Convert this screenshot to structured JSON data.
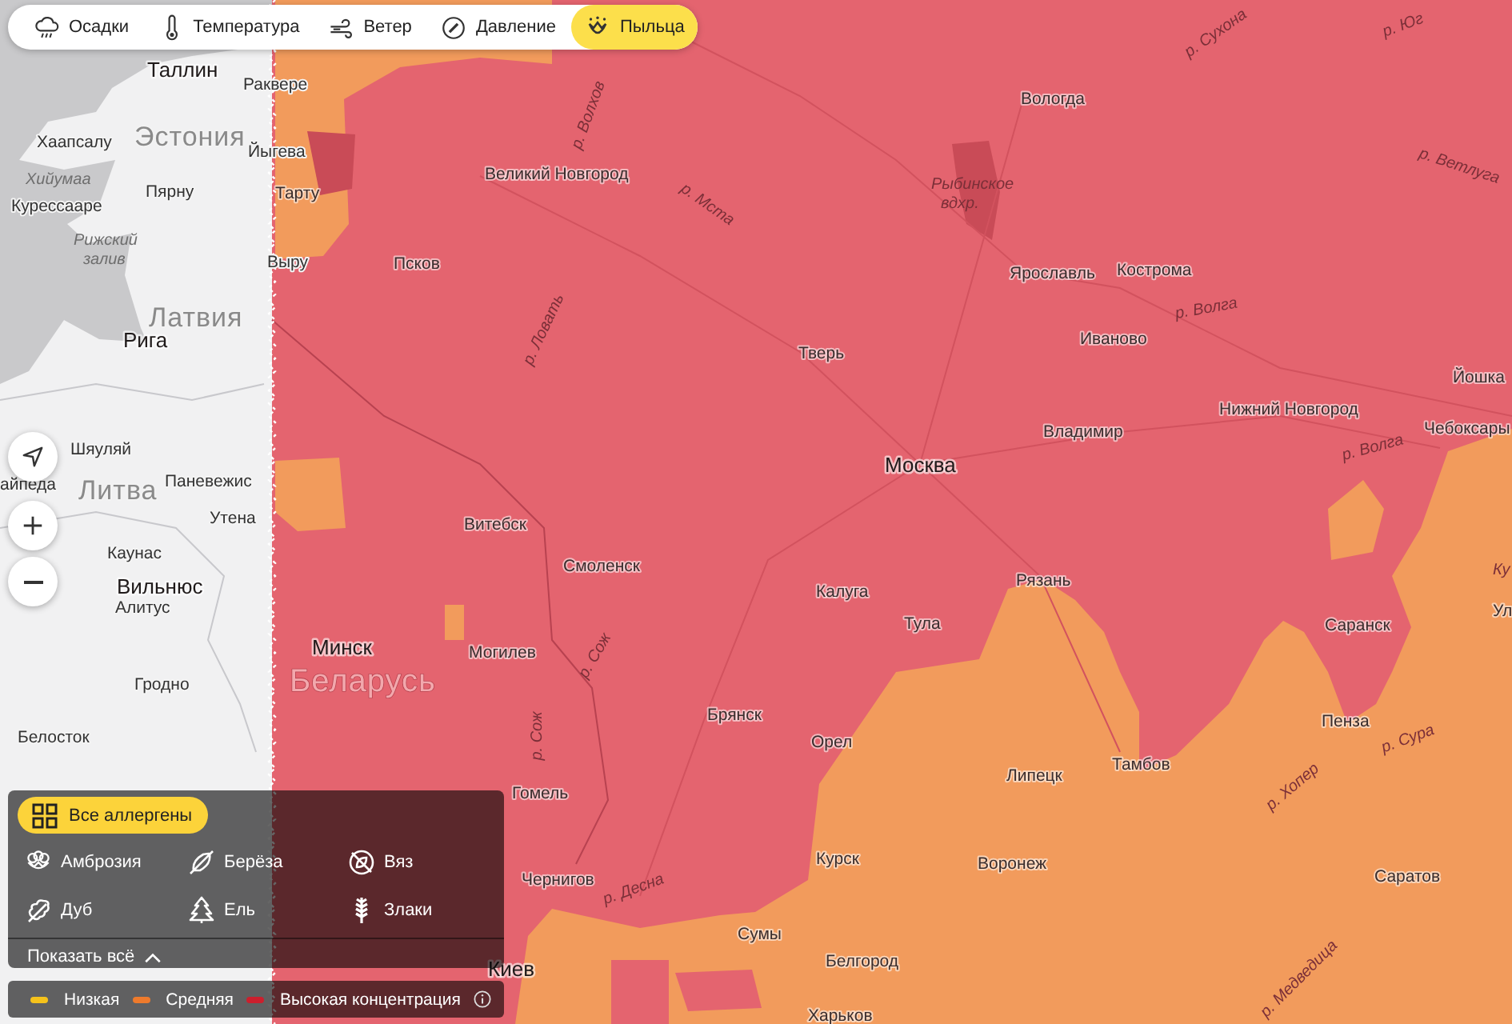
{
  "toolbar": {
    "layers": [
      {
        "label": "Осадки",
        "selected": false
      },
      {
        "label": "Температура",
        "selected": false
      },
      {
        "label": "Ветер",
        "selected": false
      },
      {
        "label": "Давление",
        "selected": false
      },
      {
        "label": "Пыльца",
        "selected": true
      }
    ]
  },
  "map": {
    "labels": [
      {
        "text": "Таллин",
        "kind": "capital"
      },
      {
        "text": "Раквере",
        "kind": "city"
      },
      {
        "text": "Хаапсалу",
        "kind": "city"
      },
      {
        "text": "Эстония",
        "kind": "country"
      },
      {
        "text": "Йыгева",
        "kind": "city"
      },
      {
        "text": "Хийумаа",
        "kind": "water"
      },
      {
        "text": "Пярну",
        "kind": "city"
      },
      {
        "text": "Тарту",
        "kind": "city"
      },
      {
        "text": "Великий Новгород",
        "kind": "city"
      },
      {
        "text": "Курессааре",
        "kind": "city"
      },
      {
        "text": "Рижский залив",
        "kind": "water"
      },
      {
        "text": "Выру",
        "kind": "city"
      },
      {
        "text": "Псков",
        "kind": "city"
      },
      {
        "text": "Латвия",
        "kind": "country"
      },
      {
        "text": "Рига",
        "kind": "capital"
      },
      {
        "text": "Шяуляй",
        "kind": "city"
      },
      {
        "text": "айпеда",
        "kind": "city"
      },
      {
        "text": "Паневежис",
        "kind": "city"
      },
      {
        "text": "Литва",
        "kind": "country"
      },
      {
        "text": "Утена",
        "kind": "city"
      },
      {
        "text": "Каунас",
        "kind": "city"
      },
      {
        "text": "Вильнюс",
        "kind": "capital"
      },
      {
        "text": "Алитус",
        "kind": "city"
      },
      {
        "text": "Минск",
        "kind": "capital"
      },
      {
        "text": "Гродно",
        "kind": "city"
      },
      {
        "text": "Беларусь",
        "kind": "country"
      },
      {
        "text": "Белосток",
        "kind": "city"
      },
      {
        "text": "р. Сухона",
        "kind": "river"
      },
      {
        "text": "р. Юг",
        "kind": "river"
      },
      {
        "text": "р. Волхов",
        "kind": "river"
      },
      {
        "text": "Вологда",
        "kind": "city"
      },
      {
        "text": "р. Мста",
        "kind": "river"
      },
      {
        "text": "Рыбинское вдхр.",
        "kind": "water"
      },
      {
        "text": "р. Ветлуга",
        "kind": "river"
      },
      {
        "text": "Ярославль",
        "kind": "city"
      },
      {
        "text": "Кострома",
        "kind": "city"
      },
      {
        "text": "р. Ловать",
        "kind": "river"
      },
      {
        "text": "р. Волга",
        "kind": "river"
      },
      {
        "text": "Тверь",
        "kind": "city"
      },
      {
        "text": "Иваново",
        "kind": "city"
      },
      {
        "text": "Йошка",
        "kind": "city"
      },
      {
        "text": "Нижний Новгород",
        "kind": "city"
      },
      {
        "text": "Владимир",
        "kind": "city"
      },
      {
        "text": "р. Волга",
        "kind": "river"
      },
      {
        "text": "Чебоксары",
        "kind": "city"
      },
      {
        "text": "Москва",
        "kind": "capital"
      },
      {
        "text": "Витебск",
        "kind": "city"
      },
      {
        "text": "Смоленск",
        "kind": "city"
      },
      {
        "text": "Калуга",
        "kind": "city"
      },
      {
        "text": "Рязань",
        "kind": "city"
      },
      {
        "text": "Ку",
        "kind": "river"
      },
      {
        "text": "Могилев",
        "kind": "city"
      },
      {
        "text": "р. Сож",
        "kind": "river"
      },
      {
        "text": "Тула",
        "kind": "city"
      },
      {
        "text": "Саранск",
        "kind": "city"
      },
      {
        "text": "Ул",
        "kind": "city"
      },
      {
        "text": "р. Сож",
        "kind": "river"
      },
      {
        "text": "Брянск",
        "kind": "city"
      },
      {
        "text": "Орел",
        "kind": "city"
      },
      {
        "text": "Пенза",
        "kind": "city"
      },
      {
        "text": "р. Сура",
        "kind": "river"
      },
      {
        "text": "Гомель",
        "kind": "city"
      },
      {
        "text": "Липецк",
        "kind": "city"
      },
      {
        "text": "Тамбов",
        "kind": "city"
      },
      {
        "text": "р. Хопер",
        "kind": "river"
      },
      {
        "text": "Чернигов",
        "kind": "city"
      },
      {
        "text": "р. Десна",
        "kind": "river"
      },
      {
        "text": "Курск",
        "kind": "city"
      },
      {
        "text": "Воронеж",
        "kind": "city"
      },
      {
        "text": "Саратов",
        "kind": "city"
      },
      {
        "text": "Киев",
        "kind": "capital"
      },
      {
        "text": "Сумы",
        "kind": "city"
      },
      {
        "text": "Белгород",
        "kind": "city"
      },
      {
        "text": "р. Медведица",
        "kind": "river"
      },
      {
        "text": "Харьков",
        "kind": "city"
      }
    ]
  },
  "allergen_filter": {
    "all": {
      "label": "Все аллергены",
      "selected": true
    },
    "allergens": [
      {
        "label": "Амброзия",
        "selected": false
      },
      {
        "label": "Берёза",
        "selected": false
      },
      {
        "label": "Вяз",
        "selected": false
      },
      {
        "label": "Дуб",
        "selected": false
      },
      {
        "label": "Ель",
        "selected": false
      },
      {
        "label": "Злаки",
        "selected": false
      }
    ],
    "show_all": {
      "label": "Показать всё",
      "expanded": true
    }
  },
  "legend": {
    "items": [
      {
        "label": "Низкая",
        "color": "#f5c21b"
      },
      {
        "label": "Средняя",
        "color": "#ee7a2c"
      },
      {
        "label": "Высокая концентрация",
        "color": "#cc1f2d"
      }
    ]
  }
}
